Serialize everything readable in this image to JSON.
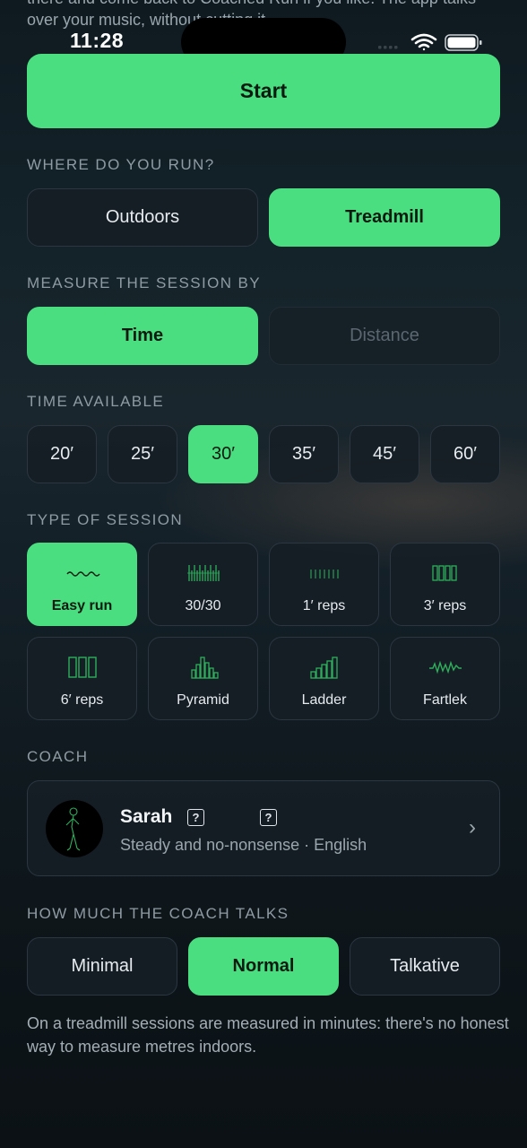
{
  "intro": {
    "text": "there and come back to Coached Run if you like. The app talks over your music, without cutting it."
  },
  "status_bar": {
    "time": "11:28"
  },
  "start_button": {
    "label": "Start"
  },
  "where_section": {
    "label": "WHERE DO YOU RUN?",
    "options": [
      {
        "label": "Outdoors",
        "selected": false
      },
      {
        "label": "Treadmill",
        "selected": true
      }
    ]
  },
  "measure_section": {
    "label": "MEASURE THE SESSION BY",
    "options": [
      {
        "label": "Time",
        "selected": true,
        "enabled": true
      },
      {
        "label": "Distance",
        "selected": false,
        "enabled": false
      }
    ]
  },
  "time_section": {
    "label": "TIME AVAILABLE",
    "options": [
      {
        "label": "20′",
        "selected": false
      },
      {
        "label": "25′",
        "selected": false
      },
      {
        "label": "30′",
        "selected": true
      },
      {
        "label": "35′",
        "selected": false
      },
      {
        "label": "45′",
        "selected": false
      },
      {
        "label": "60′",
        "selected": false
      }
    ]
  },
  "session_section": {
    "label": "TYPE OF SESSION",
    "types": [
      {
        "label": "Easy run",
        "icon": "wave-icon",
        "selected": true
      },
      {
        "label": "30/30",
        "icon": "dense-bars-icon",
        "selected": false
      },
      {
        "label": "1′ reps",
        "icon": "short-bars-icon",
        "selected": false
      },
      {
        "label": "3′ reps",
        "icon": "medium-bars-icon",
        "selected": false
      },
      {
        "label": "6′ reps",
        "icon": "long-bars-icon",
        "selected": false
      },
      {
        "label": "Pyramid",
        "icon": "pyramid-icon",
        "selected": false
      },
      {
        "label": "Ladder",
        "icon": "ladder-icon",
        "selected": false
      },
      {
        "label": "Fartlek",
        "icon": "zigzag-icon",
        "selected": false
      }
    ]
  },
  "coach_section": {
    "label": "COACH",
    "name": "Sarah",
    "badge_1": "?",
    "badge_2": "?",
    "description": "Steady and no-nonsense · English",
    "chevron": "›"
  },
  "talk_section": {
    "label": "HOW MUCH THE COACH TALKS",
    "options": [
      {
        "label": "Minimal",
        "selected": false
      },
      {
        "label": "Normal",
        "selected": true
      },
      {
        "label": "Talkative",
        "selected": false
      }
    ]
  },
  "footer_note": {
    "text": "On a treadmill sessions are measured in minutes: there's no honest way to measure metres indoors."
  },
  "colors": {
    "accent": "#4ade80",
    "background": "#0f181d",
    "card": "#161e25"
  }
}
